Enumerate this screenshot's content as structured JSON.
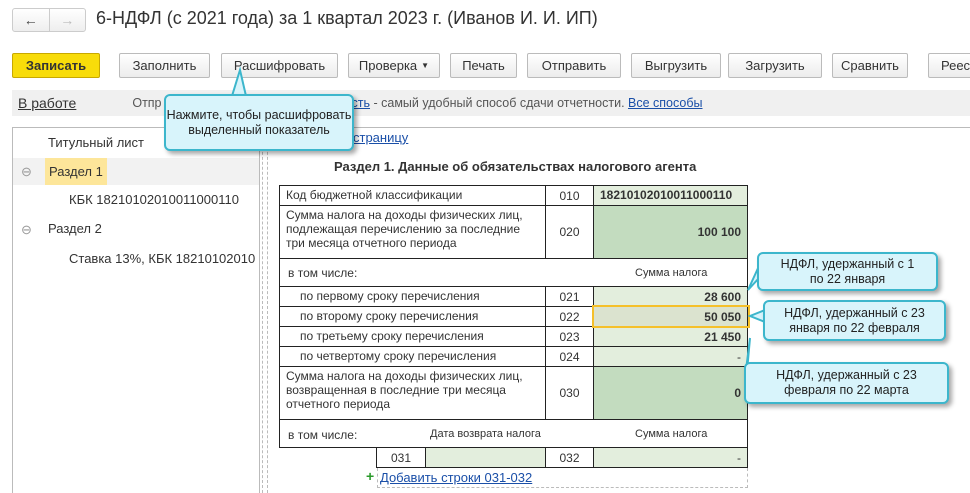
{
  "window": {
    "title": "6-НДФЛ (с 2021 года) за 1 квартал 2023 г. (Иванов И. И. ИП)",
    "back_icon": "←",
    "forward_icon": "→"
  },
  "toolbar": {
    "save": "Записать",
    "fill": "Заполнить",
    "decode": "Расшифровать",
    "check": "Проверка",
    "print": "Печать",
    "send": "Отправить",
    "export": "Выгрузить",
    "import": "Загрузить",
    "compare": "Сравнить",
    "registry": "Реестр"
  },
  "status": {
    "state": "В работе",
    "text_prefix": "Отпр",
    "link_part": "сть",
    "text_suffix": " - самый удобный способ сдачи отчетности. ",
    "all_methods": "Все способы"
  },
  "tree": {
    "items": [
      {
        "label": "Титульный лист"
      },
      {
        "label": "Раздел 1"
      },
      {
        "label": "КБК 18210102010011000110"
      },
      {
        "label": "Раздел 2"
      },
      {
        "label": "Ставка 13%, КБК 18210102010"
      }
    ]
  },
  "page_link": "страницу",
  "section": {
    "heading": "Раздел 1. Данные об обязательствах налогового агента",
    "kbk_label": "Код бюджетной классификации",
    "kbk_code": "010",
    "kbk_value": "18210102010011000110",
    "sum_label": "Сумма налога на доходы физических лиц, подлежащая перечислению за последние три месяца отчетного периода",
    "sum_code": "020",
    "sum_value": "100 100",
    "incl": "в том числе:",
    "tax_sum": "Сумма налога",
    "rows": [
      {
        "label": "по первому сроку перечисления",
        "code": "021",
        "value": "28 600"
      },
      {
        "label": "по второму сроку перечисления",
        "code": "022",
        "value": "50 050"
      },
      {
        "label": "по третьему сроку перечисления",
        "code": "023",
        "value": "21 450"
      },
      {
        "label": "по четвертому сроку перечисления",
        "code": "024",
        "value": "-"
      }
    ],
    "ret_label": "Сумма налога на доходы физических лиц, возвращенная в последние три месяца отчетного периода",
    "ret_code": "030",
    "ret_value": "0",
    "incl2": "в том числе:",
    "ret_date": "Дата возврата налога",
    "tax_sum2": "Сумма налога",
    "code031": "031",
    "code032": "032",
    "val032": "-",
    "add_rows": "Добавить строки 031-032"
  },
  "callouts": {
    "decode_tip": "Нажмите, чтобы расшифровать выделенный показатель",
    "c1": "НДФЛ, удержанный с 1 по 22 января",
    "c2": "НДФЛ, удержанный с 23 января по 22 февраля",
    "c3": "НДФЛ, удержанный с 23 февраля по 22 марта"
  }
}
